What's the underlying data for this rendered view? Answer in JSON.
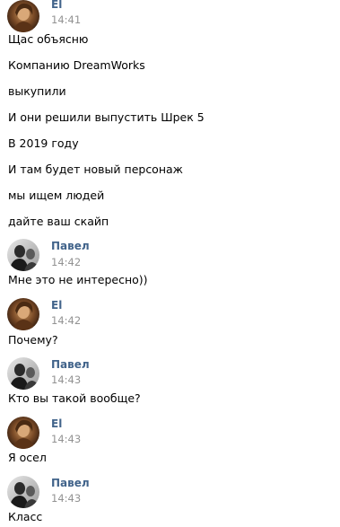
{
  "colors": {
    "author": "#42648b",
    "time": "#939393",
    "text": "#000000",
    "background": "#ffffff"
  },
  "users": {
    "el": {
      "name": "El",
      "avatar_icon": "user-avatar-el-icon"
    },
    "pavel": {
      "name": "Павел",
      "avatar_icon": "user-avatar-pavel-icon"
    }
  },
  "groups": [
    {
      "author": "El",
      "time": "14:41",
      "messages": [
        "Щас объясню",
        "Компанию DreamWorks",
        "выкупили",
        "И они решили выпустить Шрек 5",
        "В 2019 году",
        "И там будет новый персонаж",
        "мы ищем людей",
        "дайте ваш скайп"
      ]
    },
    {
      "author": "Павел",
      "time": "14:42",
      "messages": [
        "Мне это не интересно))"
      ]
    },
    {
      "author": "El",
      "time": "14:42",
      "messages": [
        "Почему?"
      ]
    },
    {
      "author": "Павел",
      "time": "14:43",
      "messages": [
        "Кто вы такой вообще?"
      ]
    },
    {
      "author": "El",
      "time": "14:43",
      "messages": [
        "Я осел"
      ]
    },
    {
      "author": "Павел",
      "time": "14:43",
      "messages": [
        "Класс"
      ]
    }
  ]
}
